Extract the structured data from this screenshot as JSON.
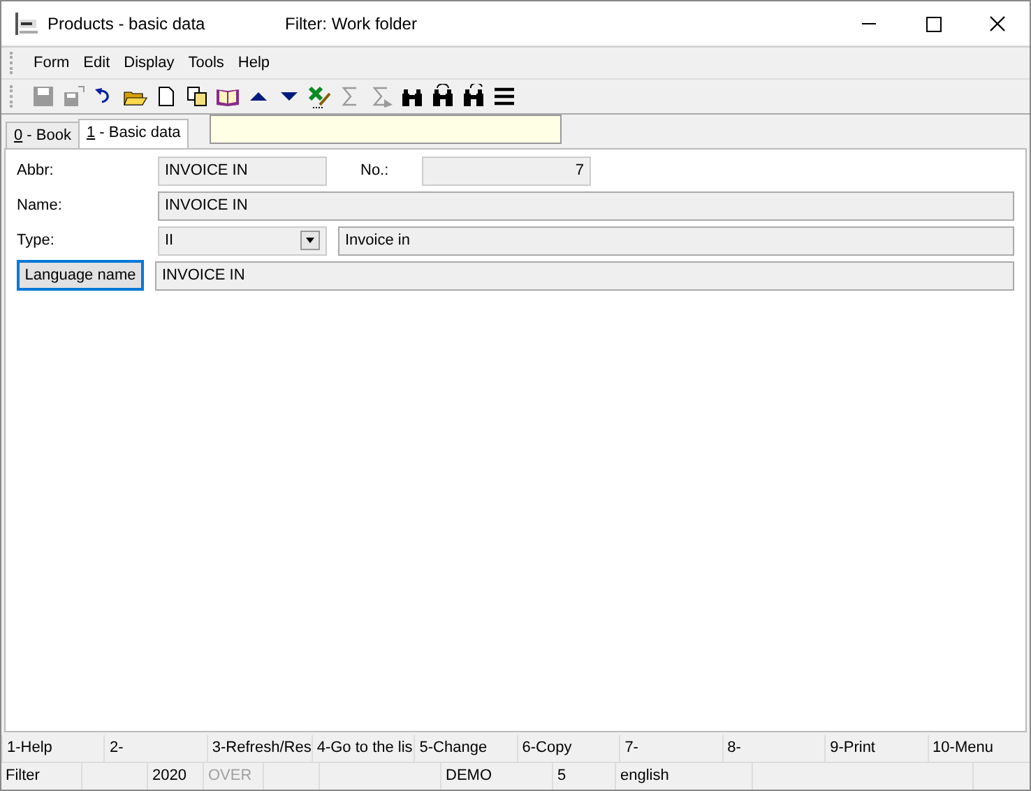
{
  "window": {
    "title": "Products - basic data",
    "filter": "Filter: Work folder"
  },
  "menu": [
    "Form",
    "Edit",
    "Display",
    "Tools",
    "Help"
  ],
  "toolbar": [
    {
      "kind": "save",
      "disabled": true
    },
    {
      "kind": "saveas",
      "disabled": true
    },
    {
      "kind": "undo",
      "disabled": false
    },
    {
      "kind": "folder",
      "disabled": false
    },
    {
      "kind": "page",
      "disabled": false
    },
    {
      "kind": "copy",
      "disabled": false
    },
    {
      "kind": "book",
      "disabled": false
    },
    {
      "kind": "up",
      "disabled": false
    },
    {
      "kind": "down",
      "disabled": false
    },
    {
      "kind": "sheet",
      "disabled": false
    },
    {
      "kind": "sigma",
      "disabled": true
    },
    {
      "kind": "sigma2",
      "disabled": true
    },
    {
      "kind": "binoculars",
      "disabled": false
    },
    {
      "kind": "binoback",
      "disabled": false
    },
    {
      "kind": "binofwd",
      "disabled": false
    },
    {
      "kind": "lines",
      "disabled": false
    }
  ],
  "tabs": [
    {
      "key": "0",
      "label": " - Book",
      "selected": false
    },
    {
      "key": "1",
      "label": " - Basic data",
      "selected": true
    }
  ],
  "form": {
    "abbr_label": "Abbr:",
    "abbr": "INVOICE IN",
    "no_label": "No.:",
    "no": "7",
    "name_label": "Name:",
    "name": "INVOICE IN",
    "type_label": "Type:",
    "type": "II",
    "type_desc": "Invoice in",
    "lang_button": "Language name",
    "lang_name": "INVOICE IN"
  },
  "function_keys": [
    "1-Help",
    "2-",
    "3-Refresh/Res",
    "4-Go to the lis",
    "5-Change",
    "6-Copy",
    "7-",
    "8-",
    "9-Print",
    "10-Menu"
  ],
  "status_bar": [
    {
      "kind": "text",
      "text": "Filter",
      "disabled": false
    },
    {
      "kind": "blank"
    },
    {
      "kind": "text",
      "text": "2020",
      "disabled": false
    },
    {
      "kind": "text",
      "text": "OVER",
      "disabled": true
    },
    {
      "kind": "blank"
    },
    {
      "kind": "blank"
    },
    {
      "kind": "text",
      "text": "DEMO",
      "disabled": false
    },
    {
      "kind": "text",
      "text": "5",
      "disabled": false
    },
    {
      "kind": "text",
      "text": "english",
      "disabled": false
    },
    {
      "kind": "blank"
    }
  ]
}
